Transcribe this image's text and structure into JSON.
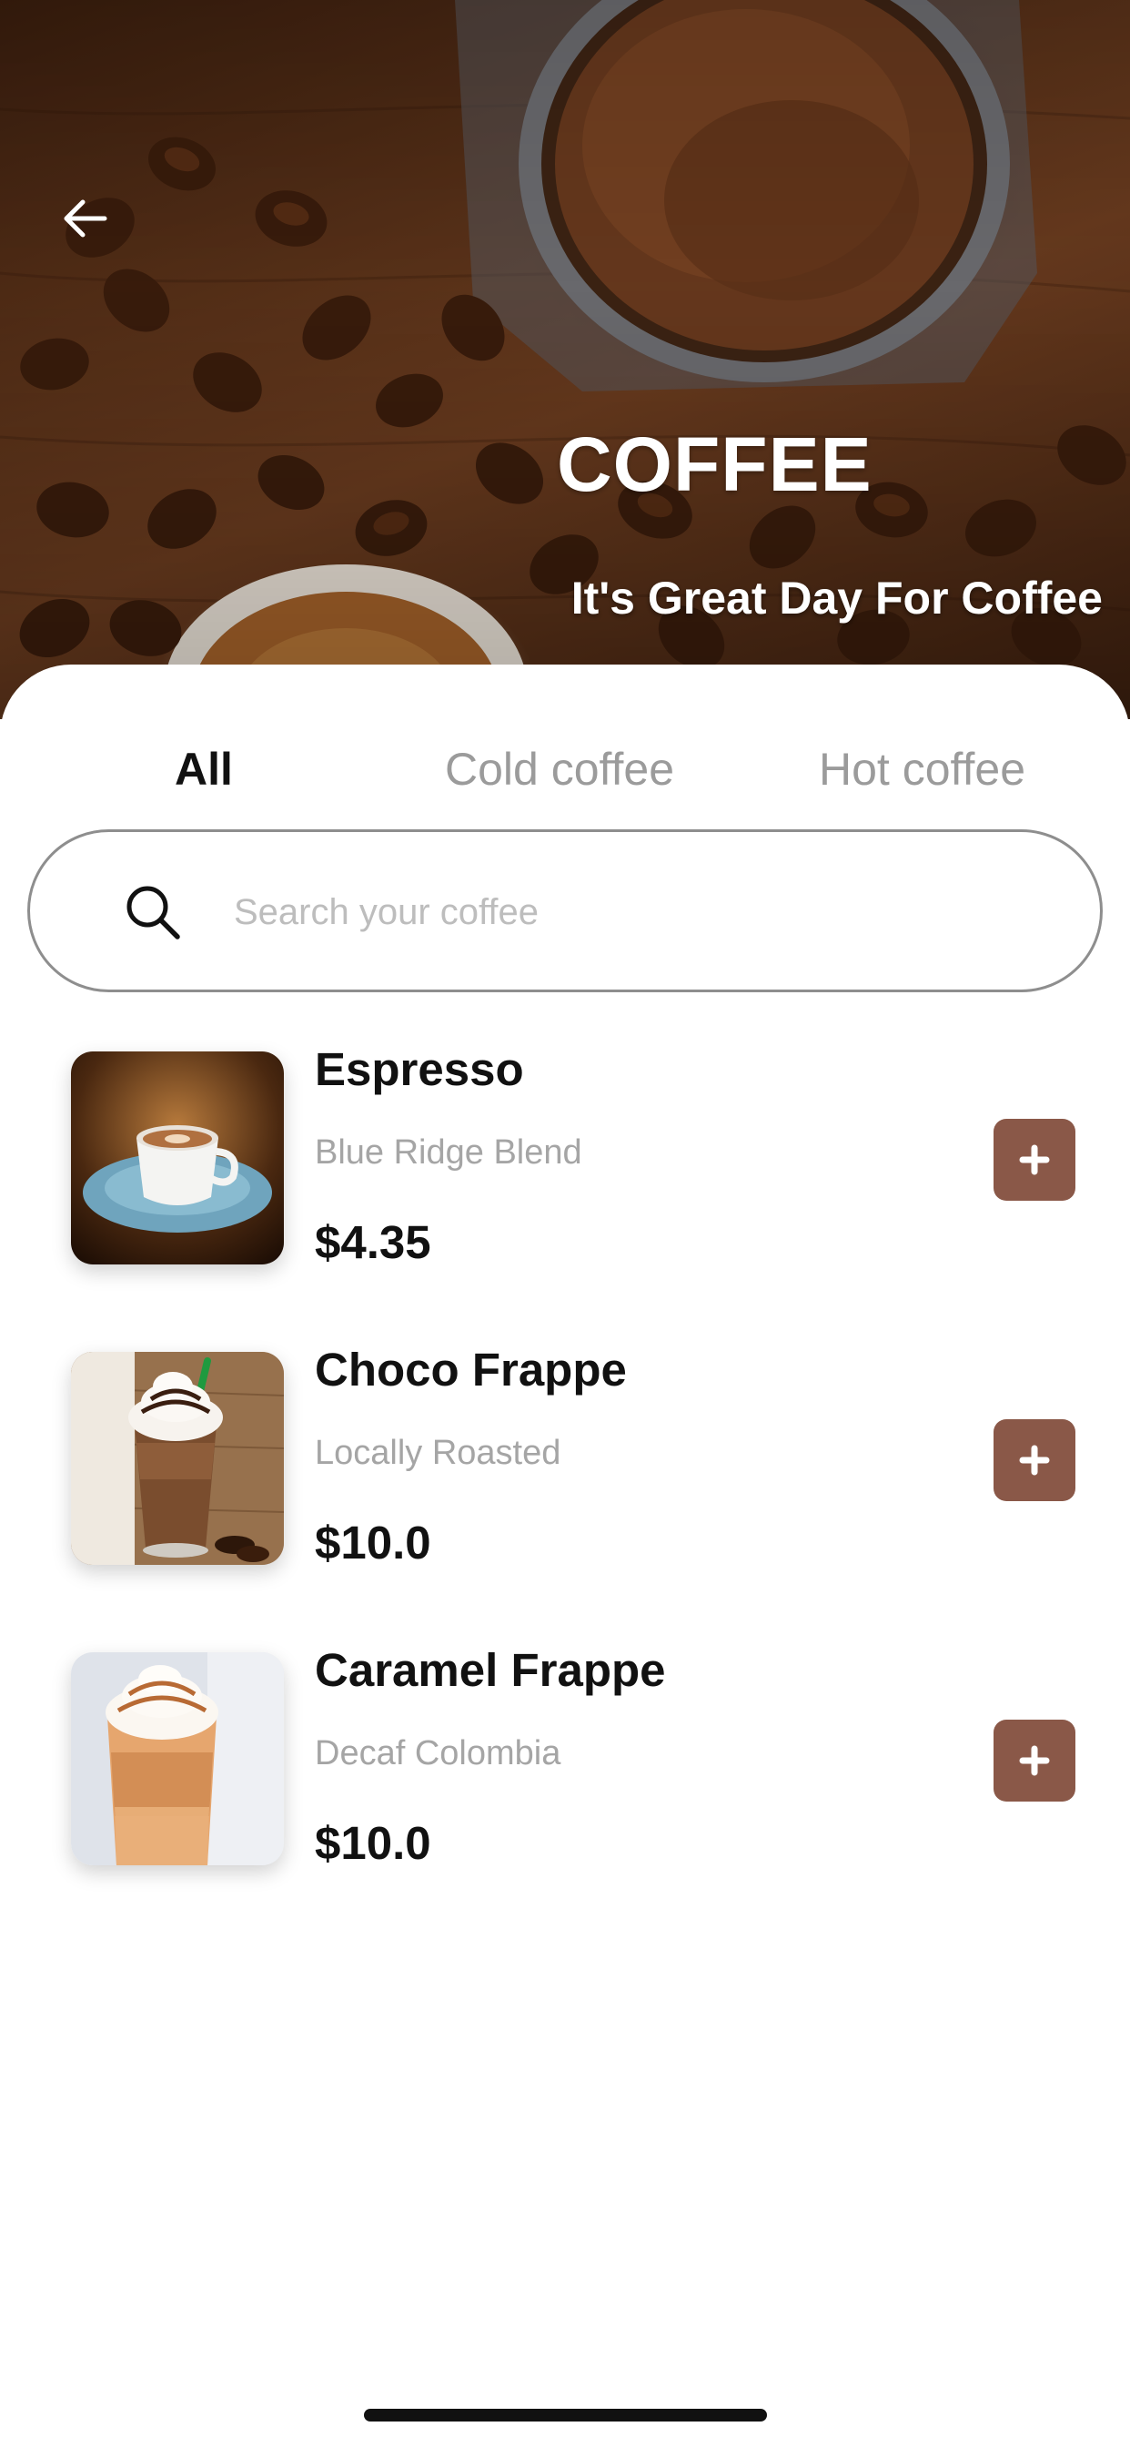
{
  "hero": {
    "title": "COFFEE",
    "subtitle": "It's Great Day For Coffee",
    "back_icon": "arrow-left-icon"
  },
  "tabs": [
    {
      "label": "All",
      "active": true
    },
    {
      "label": "Cold coffee",
      "active": false
    },
    {
      "label": "Hot coffee",
      "active": false
    }
  ],
  "search": {
    "placeholder": "Search your coffee",
    "value": "",
    "icon": "search-icon"
  },
  "products": [
    {
      "name": "Espresso",
      "origin": "Blue Ridge Blend",
      "price": "$4.35",
      "image": "espresso-cup-image"
    },
    {
      "name": "Choco Frappe",
      "origin": "Locally Roasted",
      "price": "$10.0",
      "image": "choco-frappe-image"
    },
    {
      "name": "Caramel Frappe",
      "origin": "Decaf Colombia",
      "price": "$10.0",
      "image": "caramel-frappe-image"
    }
  ],
  "colors": {
    "accent": "#8a5848",
    "text_primary": "#111111",
    "text_secondary": "#a5a5a5",
    "tab_inactive": "#9b9b9b"
  }
}
